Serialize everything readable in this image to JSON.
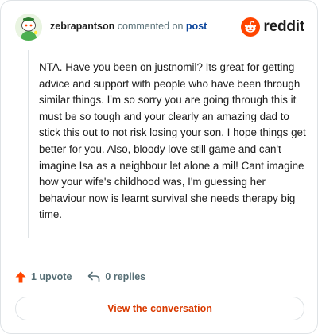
{
  "header": {
    "username": "zebrapantson",
    "action_text": "commented on",
    "post_link": "post",
    "logo_text": "reddit"
  },
  "comment": {
    "text": "NTA. Have you been on justnomil? Its great for getting advice and support with people who have been through similar things. I'm so sorry you are going through this it must be so tough and your clearly an amazing dad to stick this out to not risk losing your son. I hope things get better for you. Also, bloody love still game and can't imagine Isa as a neighbour let alone a mil! Cant imagine how your wife's childhood was, I'm guessing her behaviour now is learnt survival she needs therapy big time."
  },
  "footer": {
    "upvotes": "1 upvote",
    "replies": "0 replies"
  },
  "cta": {
    "label": "View the conversation"
  },
  "icons": {
    "avatar": "snoo-avatar-icon",
    "logo": "reddit-logo-icon",
    "upvote": "upvote-arrow-icon",
    "reply": "reply-arrow-icon"
  },
  "colors": {
    "brand": "#ff4500",
    "link": "#0a449b",
    "cta": "#d93a00",
    "muted": "#576f76"
  }
}
